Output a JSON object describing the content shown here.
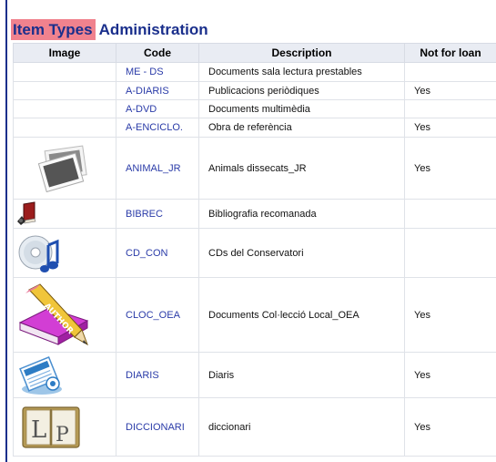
{
  "page": {
    "title_highlight": "Item Types",
    "title_rest": "Administration"
  },
  "table": {
    "headers": {
      "image": "Image",
      "code": "Code",
      "description": "Description",
      "not_for_loan": "Not for loan"
    },
    "rows": [
      {
        "code": "ME - DS",
        "description": "Documents sala lectura prestables",
        "not_for_loan": "",
        "icon": ""
      },
      {
        "code": "A-DIARIS",
        "description": "Publicacions periòdiques",
        "not_for_loan": "Yes",
        "icon": ""
      },
      {
        "code": "A-DVD",
        "description": "Documents multimèdia",
        "not_for_loan": "",
        "icon": ""
      },
      {
        "code": "A-ENCICLO.",
        "description": "Obra de referència",
        "not_for_loan": "Yes",
        "icon": ""
      },
      {
        "code": "ANIMAL_JR",
        "description": "Animals dissecats_JR",
        "not_for_loan": "Yes",
        "icon": "photo-frames-icon"
      },
      {
        "code": "BIBREC",
        "description": "Bibliografia recomanada",
        "not_for_loan": "",
        "icon": "red-book-icon"
      },
      {
        "code": "CD_CON",
        "description": "CDs del Conservatori",
        "not_for_loan": "",
        "icon": "cd-music-note-icon"
      },
      {
        "code": "CLOC_OEA",
        "description": "Documents Col·lecció Local_OEA",
        "not_for_loan": "Yes",
        "icon": "author-pencil-book-icon"
      },
      {
        "code": "DIARIS",
        "description": "Diaris",
        "not_for_loan": "Yes",
        "icon": "newspaper-icon"
      },
      {
        "code": "DICCIONARI",
        "description": "diccionari",
        "not_for_loan": "Yes",
        "icon": "dictionary-lp-icon"
      }
    ]
  },
  "colors": {
    "title": "#1a2f8c",
    "title_highlight_bg": "#f0828e",
    "header_bg": "#e9ecf3",
    "code_link": "#2a3ba8"
  }
}
